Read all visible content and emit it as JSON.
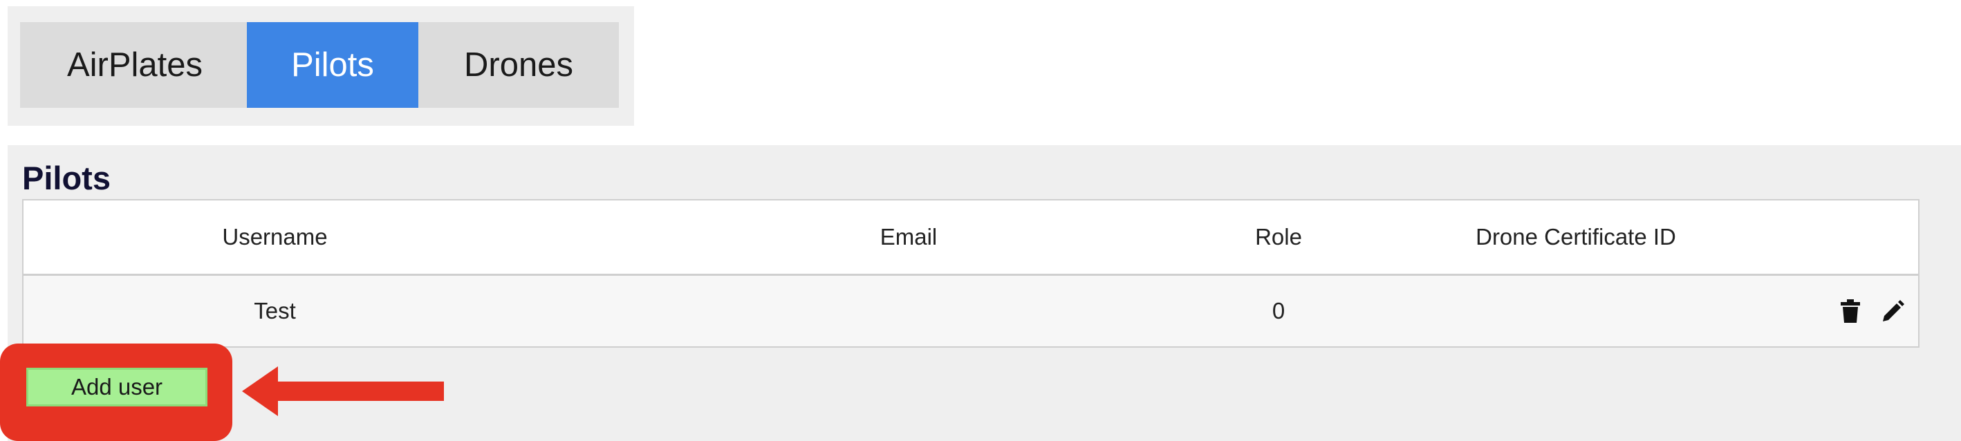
{
  "tabs": [
    {
      "label": "AirPlates",
      "active": false
    },
    {
      "label": "Pilots",
      "active": true
    },
    {
      "label": "Drones",
      "active": false
    }
  ],
  "section": {
    "title": "Pilots"
  },
  "table": {
    "columns": [
      "Username",
      "Email",
      "Role",
      "Drone Certificate ID"
    ],
    "rows": [
      {
        "username": "Test",
        "email": "",
        "role": "0",
        "certificate_id": ""
      }
    ],
    "row_actions": [
      "trash-icon",
      "pencil-icon"
    ]
  },
  "actions": {
    "add_user_label": "Add user"
  },
  "annotation": {
    "highlight_color": "#e63323",
    "arrow_color": "#e63323"
  },
  "colors": {
    "active_tab": "#3d85e5",
    "add_button": "#a6ef93"
  }
}
